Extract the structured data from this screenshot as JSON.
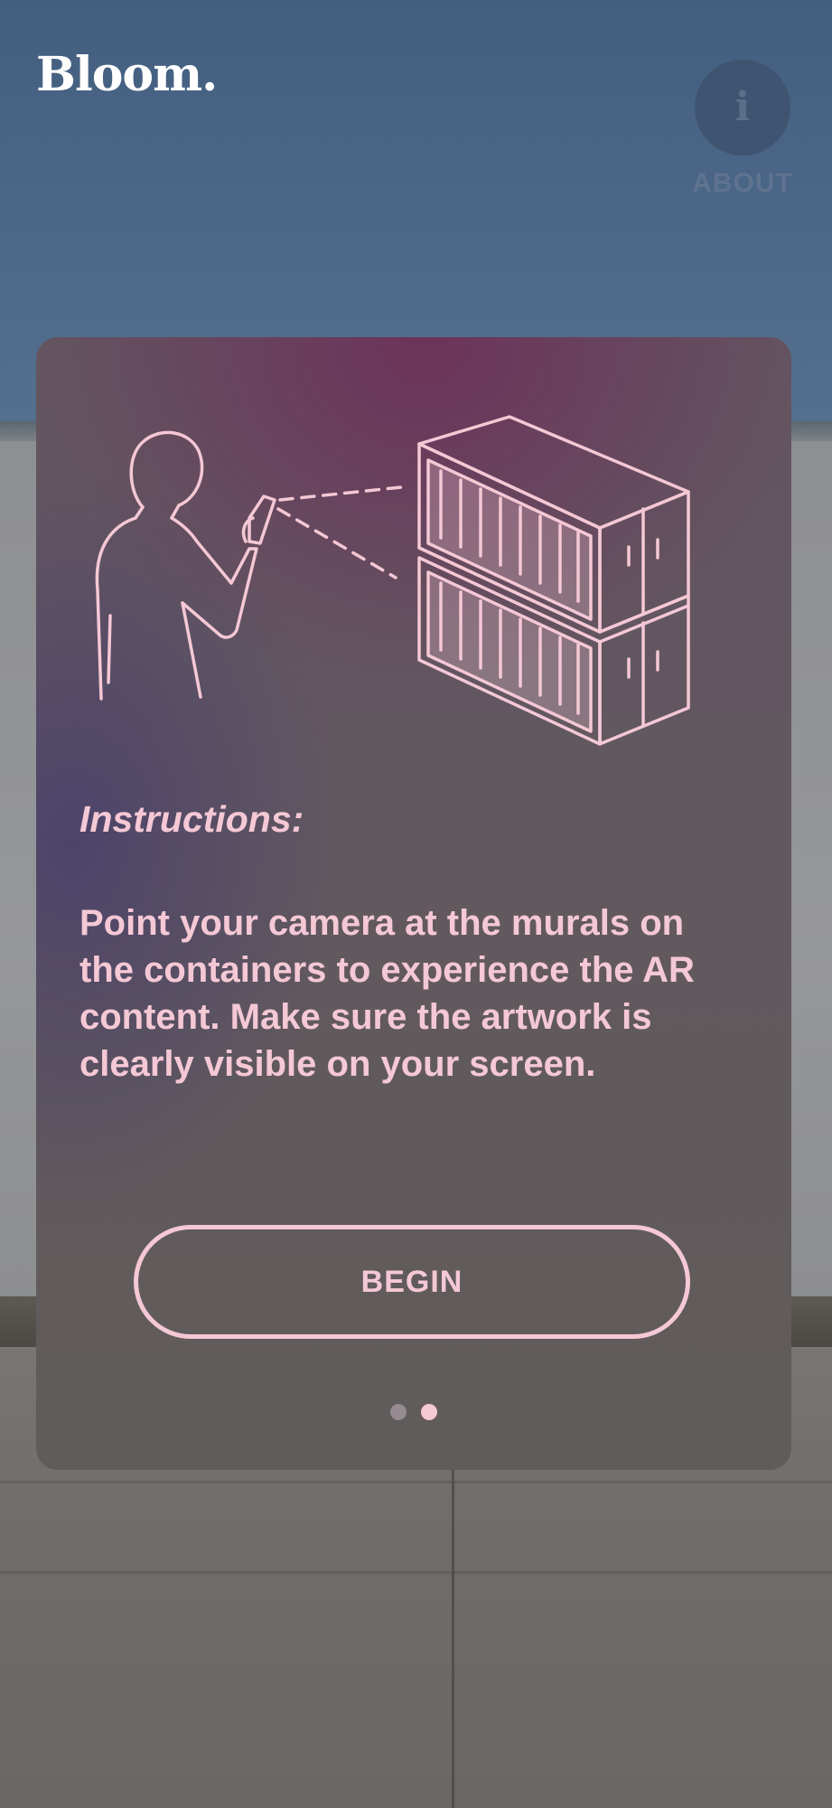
{
  "header": {
    "logo": "Bloom.",
    "about_icon": "info-icon",
    "about_glyph": "i",
    "about_label": "ABOUT"
  },
  "card": {
    "illustration": "person-scanning-containers-illustration",
    "instructions_title": "Instructions:",
    "instructions_body": "Point your camera at the murals on the containers to experience the AR content. Make sure the artwork is clearly visible on your screen.",
    "begin_label": "BEGIN",
    "pagination": {
      "total": 2,
      "current": 2
    }
  },
  "colors": {
    "accent": "#f5c8d5",
    "card_background": "#625860",
    "sky": "#435f80"
  }
}
